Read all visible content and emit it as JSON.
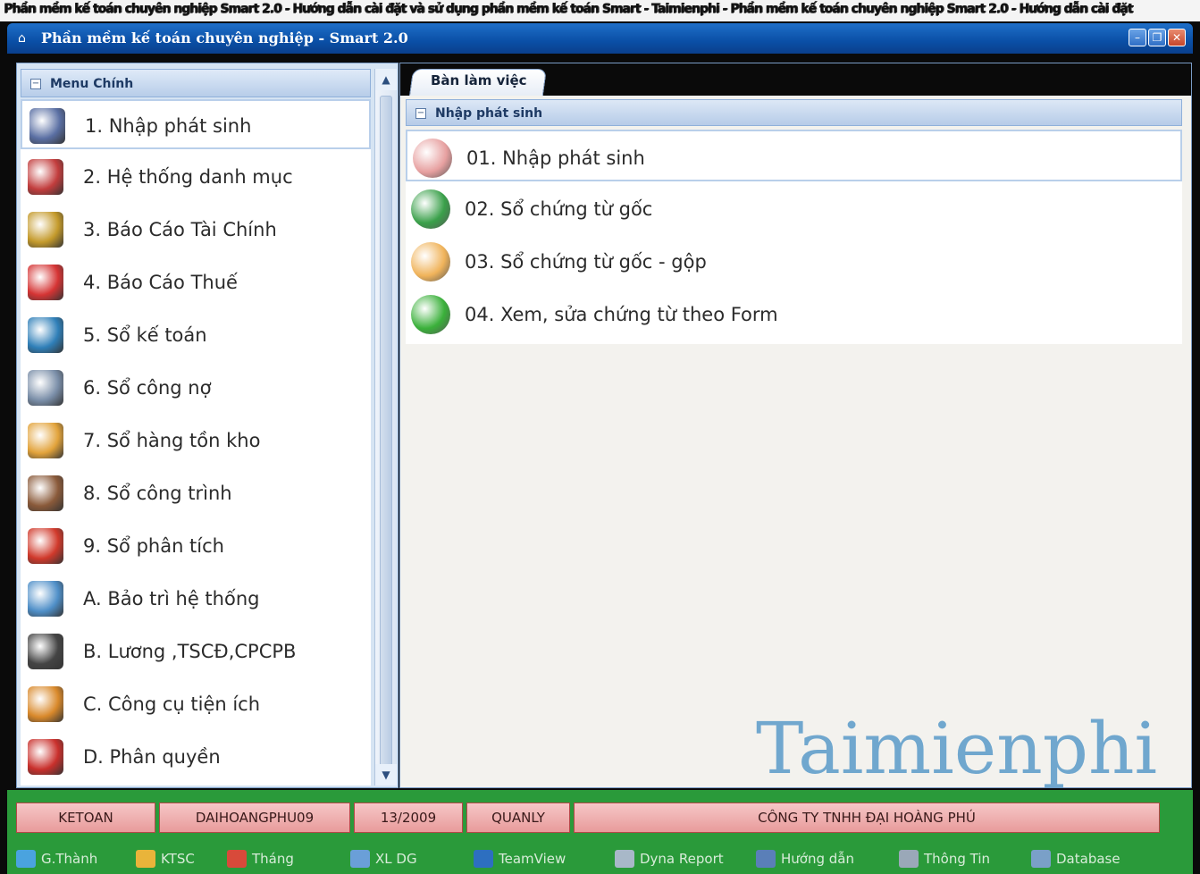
{
  "top_strip": {
    "text": "Phần mềm kế toán chuyên nghiệp Smart 2.0 - Hướng dẫn cài đặt và sử dụng phần mềm kế toán Smart - Taimienphi - Phần mềm kế toán chuyên nghiệp Smart 2.0 - Hướng dẫn cài đặt"
  },
  "window": {
    "title": "Phần mềm kế toán chuyên nghiệp - Smart 2.0",
    "app_icon": "house-icon",
    "buttons": [
      "minimize-icon",
      "restore-icon",
      "close-icon"
    ]
  },
  "left_menu": {
    "header": "Menu Chính",
    "items": [
      {
        "label": "1. Nhập phát sinh",
        "icon": "pen-notebook-icon",
        "color": "#5a6fa3"
      },
      {
        "label": "2. Hệ thống danh mục",
        "icon": "globe-cubes-icon",
        "color": "#c23d3d"
      },
      {
        "label": "3. Báo Cáo Tài Chính",
        "icon": "coins-chart-icon",
        "color": "#c49a2b"
      },
      {
        "label": "4. Báo Cáo Thuế",
        "icon": "percent-icon",
        "color": "#d53434"
      },
      {
        "label": "5. Sổ kế toán",
        "icon": "book-icon",
        "color": "#2f7fb8"
      },
      {
        "label": "6. Sổ công nợ",
        "icon": "transfer-icon",
        "color": "#7a8ea8"
      },
      {
        "label": "7. Sổ hàng tồn kho",
        "icon": "shelves-icon",
        "color": "#e2a33b"
      },
      {
        "label": "8. Sổ công trình",
        "icon": "building-icon",
        "color": "#8a5a3a"
      },
      {
        "label": "9. Sổ phân tích",
        "icon": "bar-chart-icon",
        "color": "#d0392b"
      },
      {
        "label": "A. Bảo trì hệ thống",
        "icon": "technician-icon",
        "color": "#4f8fc8"
      },
      {
        "label": "B. Lương ,TSCĐ,CPCPB",
        "icon": "car-icon",
        "color": "#444444"
      },
      {
        "label": "C. Công cụ tiện ích",
        "icon": "tools-icon",
        "color": "#d9892b"
      },
      {
        "label": "D. Phân quyền",
        "icon": "users-icon",
        "color": "#c9302c"
      }
    ]
  },
  "workspace": {
    "tab": "Bàn làm việc",
    "group_header": "Nhập phát sinh",
    "items": [
      {
        "label": "01. Nhập phát sinh",
        "icon": "pencil-diamond-icon",
        "color": "#e7a0a0"
      },
      {
        "label": "02. Sổ chứng từ gốc",
        "icon": "chrome-icon",
        "color": "#3aa04a"
      },
      {
        "label": "03. Sổ chứng từ gốc - gộp",
        "icon": "folders-icon",
        "color": "#f0b35a"
      },
      {
        "label": "04. Xem, sửa chứng từ  theo Form",
        "icon": "gear-green-icon",
        "color": "#3ab03a"
      }
    ],
    "watermark": "Taimienphi"
  },
  "statusbar": {
    "cells": [
      "KETOAN",
      "DAIHOANGPHU09",
      "13/2009",
      "QUANLY",
      "CÔNG TY TNHH ĐẠI HOÀNG PHÚ"
    ]
  },
  "toolbar": {
    "items": [
      {
        "label": "G.Thành",
        "icon": "recycle-icon",
        "color": "#4aa3df"
      },
      {
        "label": "KTSC",
        "icon": "smiley-icon",
        "color": "#e9b43a"
      },
      {
        "label": "Tháng",
        "icon": "calendar-icon",
        "color": "#d84a3a"
      },
      {
        "label": "XL DG",
        "icon": "globe-icon",
        "color": "#6a9fd8"
      },
      {
        "label": "TeamView",
        "icon": "teamviewer-icon",
        "color": "#2d6fc0"
      },
      {
        "label": "Dyna Report",
        "icon": "report-icon",
        "color": "#a8b8c8"
      },
      {
        "label": "Hướng dẫn",
        "icon": "help-icon",
        "color": "#5a7fb8"
      },
      {
        "label": "Thông Tin",
        "icon": "info-icon",
        "color": "#9aa8b8"
      },
      {
        "label": "Database",
        "icon": "database-icon",
        "color": "#7aa0c8"
      }
    ]
  }
}
